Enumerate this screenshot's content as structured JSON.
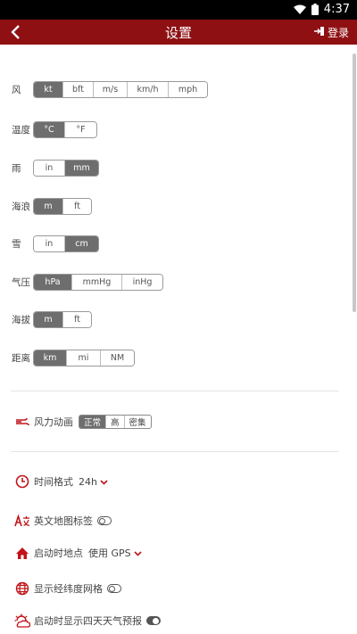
{
  "status": {
    "time": "4:37"
  },
  "header": {
    "title": "设置",
    "login_label": "登录"
  },
  "units": [
    {
      "label": "风",
      "options": [
        "kt",
        "bft",
        "m/s",
        "km/h",
        "mph"
      ],
      "selected": 0
    },
    {
      "label": "温度",
      "options": [
        "°C",
        "°F"
      ],
      "selected": 0
    },
    {
      "label": "雨",
      "options": [
        "in",
        "mm"
      ],
      "selected": 1
    },
    {
      "label": "海浪",
      "options": [
        "m",
        "ft"
      ],
      "selected": 0
    },
    {
      "label": "雪",
      "options": [
        "in",
        "cm"
      ],
      "selected": 1
    },
    {
      "label": "气压",
      "options": [
        "hPa",
        "mmHg",
        "inHg"
      ],
      "selected": 0
    },
    {
      "label": "海拔",
      "options": [
        "m",
        "ft"
      ],
      "selected": 0
    },
    {
      "label": "距离",
      "options": [
        "km",
        "mi",
        "NM"
      ],
      "selected": 0
    }
  ],
  "wind_animation": {
    "label": "风力动画",
    "options": [
      "正常",
      "高",
      "密集"
    ],
    "selected": 0
  },
  "settings": {
    "time_format": {
      "label": "时间格式",
      "value": "24h"
    },
    "english_labels": {
      "label": "英文地图标签",
      "enabled": false
    },
    "startup_location": {
      "label": "启动时地点",
      "value": "使用 GPS"
    },
    "lat_lon_grid": {
      "label": "显示经纬度网格",
      "enabled": false
    },
    "four_day_forecast": {
      "label": "启动时显示四天天气预报",
      "enabled": true
    }
  },
  "colors": {
    "brand": "#8e1013",
    "selected": "#6e6e6e",
    "accent_icon": "#c0141a"
  }
}
